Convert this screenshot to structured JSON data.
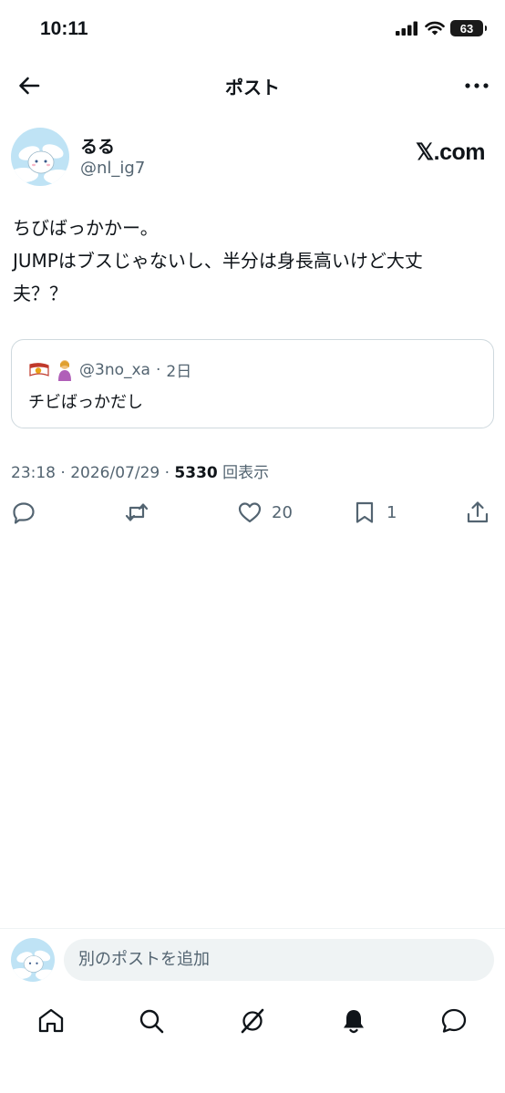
{
  "status_bar": {
    "time": "10:11",
    "battery": "63"
  },
  "header": {
    "title": "ポスト"
  },
  "author": {
    "name": "るる",
    "handle": "@nl_ig7",
    "brand": "𝕏.com"
  },
  "post": {
    "lines": [
      "ちびばっかかー。",
      "JUMPはブスじゃないし、半分は身長高いけど大丈",
      "夫？？"
    ]
  },
  "quote": {
    "handle": "@3no_xa",
    "age": "2日",
    "text": "チビばっかだし"
  },
  "meta": {
    "time": "23:18",
    "date": "2026/07/29",
    "views_count": "5330",
    "views_label": "回表示"
  },
  "actions": {
    "like_count": "20",
    "bookmark_count": "1"
  },
  "reply": {
    "placeholder": "別のポストを追加"
  },
  "icons": [
    "back-arrow-icon",
    "more-icon",
    "reply-icon",
    "repost-icon",
    "like-icon",
    "bookmark-icon",
    "share-icon",
    "home-icon",
    "search-icon",
    "grok-icon",
    "notifications-icon",
    "messages-icon"
  ]
}
